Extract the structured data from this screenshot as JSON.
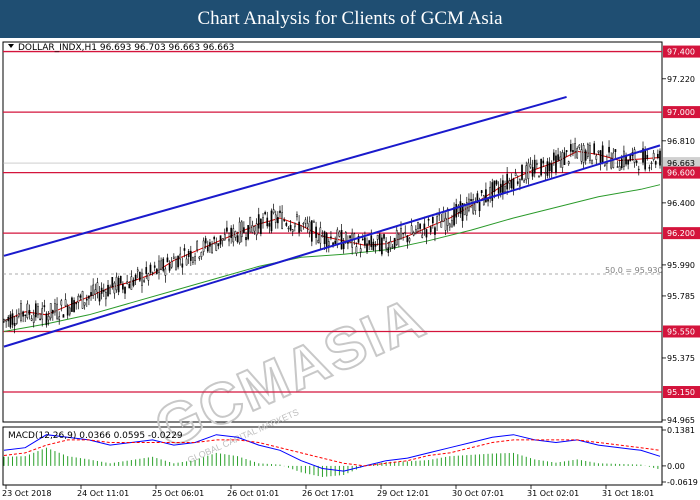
{
  "header": {
    "title": "Chart Analysis for Clients of GCM Asia"
  },
  "watermark": {
    "main_text": "GCMASIA",
    "sub_text": "GLOBAL CAPITAL MARKETS"
  },
  "chart_data": [
    {
      "type": "line",
      "chart_kind": "candlestick",
      "symbol_header": "DOLLAR_INDX,H1  96.693 96.703 96.663 96.663",
      "x_tick_labels": [
        "23 Oct 2018",
        "24 Oct 11:01",
        "25 Oct 06:01",
        "26 Oct 01:01",
        "26 Oct 17:01",
        "29 Oct 12:01",
        "30 Oct 07:01",
        "31 Oct 02:01",
        "31 Oct 18:01"
      ],
      "y_tick_labels": [
        "97.400",
        "97.220",
        "97.000",
        "96.810",
        "96.663",
        "96.600",
        "96.400",
        "96.200",
        "95.990",
        "95.785",
        "95.550",
        "95.375",
        "95.150",
        "94.965"
      ],
      "ylim": [
        94.965,
        97.45
      ],
      "last_price": 96.663,
      "horizontal_levels": [
        {
          "value": 97.4,
          "label": "97.400"
        },
        {
          "value": 97.0,
          "label": "97.000"
        },
        {
          "value": 96.6,
          "label": "96.600"
        },
        {
          "value": 96.2,
          "label": "96.200"
        },
        {
          "value": 95.55,
          "label": "95.550"
        },
        {
          "value": 95.15,
          "label": "95.150"
        }
      ],
      "fib_level": {
        "value": 95.93,
        "label": "50.0 = 95.930"
      },
      "series": [
        {
          "name": "",
          "color": "#d40000",
          "points": [
            [
              0,
              95.62
            ],
            [
              10,
              95.68
            ],
            [
              20,
              95.66
            ],
            [
              30,
              95.72
            ],
            [
              40,
              95.78
            ],
            [
              50,
              95.84
            ],
            [
              60,
              95.88
            ],
            [
              70,
              95.93
            ],
            [
              80,
              96.02
            ],
            [
              90,
              96.08
            ],
            [
              100,
              96.14
            ],
            [
              110,
              96.2
            ],
            [
              120,
              96.26
            ],
            [
              130,
              96.3
            ],
            [
              140,
              96.25
            ],
            [
              150,
              96.18
            ],
            [
              160,
              96.15
            ],
            [
              170,
              96.12
            ],
            [
              180,
              96.13
            ],
            [
              190,
              96.18
            ],
            [
              200,
              96.24
            ],
            [
              210,
              96.3
            ],
            [
              220,
              96.38
            ],
            [
              230,
              96.47
            ],
            [
              240,
              96.56
            ],
            [
              250,
              96.62
            ],
            [
              260,
              96.67
            ],
            [
              270,
              96.74
            ],
            [
              280,
              96.72
            ],
            [
              290,
              96.68
            ],
            [
              300,
              96.69
            ],
            [
              309,
              96.7
            ]
          ]
        },
        {
          "name": "",
          "color": "#2a9a2a",
          "points": [
            [
              0,
              95.55
            ],
            [
              20,
              95.6
            ],
            [
              40,
              95.66
            ],
            [
              60,
              95.74
            ],
            [
              80,
              95.82
            ],
            [
              100,
              95.9
            ],
            [
              120,
              95.98
            ],
            [
              140,
              96.04
            ],
            [
              160,
              96.06
            ],
            [
              180,
              96.09
            ],
            [
              200,
              96.15
            ],
            [
              220,
              96.22
            ],
            [
              240,
              96.3
            ],
            [
              260,
              96.37
            ],
            [
              280,
              96.44
            ],
            [
              300,
              96.49
            ],
            [
              309,
              96.52
            ]
          ]
        }
      ],
      "trend_channel": [
        {
          "points": [
            [
              0,
              96.05
            ],
            [
              265,
              97.1
            ]
          ]
        },
        {
          "points": [
            [
              0,
              95.45
            ],
            [
              309,
              96.78
            ]
          ]
        }
      ],
      "watermark_text": "GCMASIA"
    },
    {
      "type": "line",
      "title": "MACD(12,26,9) 0.0366 0.0595 -0.0229",
      "y_tick_labels": [
        "0.1381",
        "0.00",
        "-0.0619"
      ],
      "ylim": [
        -0.0619,
        0.1381
      ],
      "series": [
        {
          "name": "",
          "color": "#0000ff",
          "points": [
            [
              0,
              0.06
            ],
            [
              10,
              0.07
            ],
            [
              20,
              0.12
            ],
            [
              30,
              0.11
            ],
            [
              40,
              0.1
            ],
            [
              50,
              0.08
            ],
            [
              60,
              0.09
            ],
            [
              70,
              0.1
            ],
            [
              80,
              0.08
            ],
            [
              90,
              0.09
            ],
            [
              100,
              0.12
            ],
            [
              110,
              0.11
            ],
            [
              120,
              0.08
            ],
            [
              130,
              0.06
            ],
            [
              140,
              0.02
            ],
            [
              150,
              -0.01
            ],
            [
              160,
              -0.02
            ],
            [
              170,
              0.0
            ],
            [
              180,
              0.02
            ],
            [
              190,
              0.03
            ],
            [
              200,
              0.05
            ],
            [
              210,
              0.07
            ],
            [
              220,
              0.09
            ],
            [
              230,
              0.11
            ],
            [
              240,
              0.12
            ],
            [
              250,
              0.1
            ],
            [
              260,
              0.09
            ],
            [
              270,
              0.1
            ],
            [
              280,
              0.08
            ],
            [
              290,
              0.07
            ],
            [
              300,
              0.06
            ],
            [
              309,
              0.037
            ]
          ]
        },
        {
          "name": "",
          "color": "#ff0000",
          "points": [
            [
              0,
              0.04
            ],
            [
              10,
              0.05
            ],
            [
              20,
              0.08
            ],
            [
              30,
              0.1
            ],
            [
              40,
              0.1
            ],
            [
              50,
              0.09
            ],
            [
              60,
              0.09
            ],
            [
              70,
              0.09
            ],
            [
              80,
              0.09
            ],
            [
              90,
              0.09
            ],
            [
              100,
              0.1
            ],
            [
              110,
              0.1
            ],
            [
              120,
              0.09
            ],
            [
              130,
              0.07
            ],
            [
              140,
              0.05
            ],
            [
              150,
              0.03
            ],
            [
              160,
              0.01
            ],
            [
              170,
              0.0
            ],
            [
              180,
              0.01
            ],
            [
              190,
              0.02
            ],
            [
              200,
              0.04
            ],
            [
              210,
              0.05
            ],
            [
              220,
              0.07
            ],
            [
              230,
              0.09
            ],
            [
              240,
              0.1
            ],
            [
              250,
              0.1
            ],
            [
              260,
              0.1
            ],
            [
              270,
              0.1
            ],
            [
              280,
              0.09
            ],
            [
              290,
              0.08
            ],
            [
              300,
              0.07
            ],
            [
              309,
              0.06
            ]
          ]
        }
      ]
    }
  ]
}
